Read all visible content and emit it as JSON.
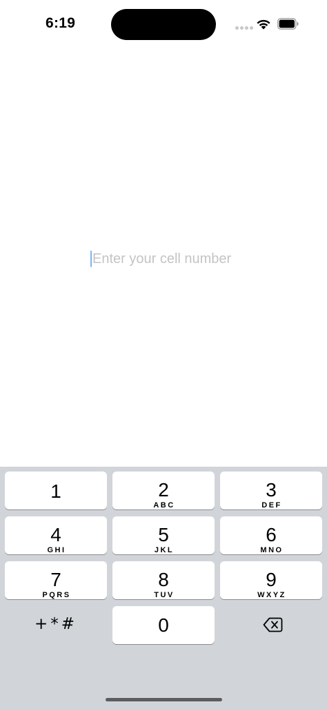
{
  "status": {
    "time": "6:19"
  },
  "form": {
    "phone_placeholder": "Enter your cell number",
    "phone_value": ""
  },
  "keypad": {
    "keys": [
      {
        "digit": "1",
        "letters": ""
      },
      {
        "digit": "2",
        "letters": "ABC"
      },
      {
        "digit": "3",
        "letters": "DEF"
      },
      {
        "digit": "4",
        "letters": "GHI"
      },
      {
        "digit": "5",
        "letters": "JKL"
      },
      {
        "digit": "6",
        "letters": "MNO"
      },
      {
        "digit": "7",
        "letters": "PQRS"
      },
      {
        "digit": "8",
        "letters": "TUV"
      },
      {
        "digit": "9",
        "letters": "WXYZ"
      },
      {
        "digit": "0",
        "letters": ""
      }
    ],
    "symbols_label": "+*#",
    "delete_icon": "delete-backspace-icon"
  },
  "colors": {
    "keyboard_bg": "#d1d4d9",
    "key_bg": "#ffffff",
    "caret": "#7fb3f5",
    "placeholder": "#c4c4c6"
  }
}
